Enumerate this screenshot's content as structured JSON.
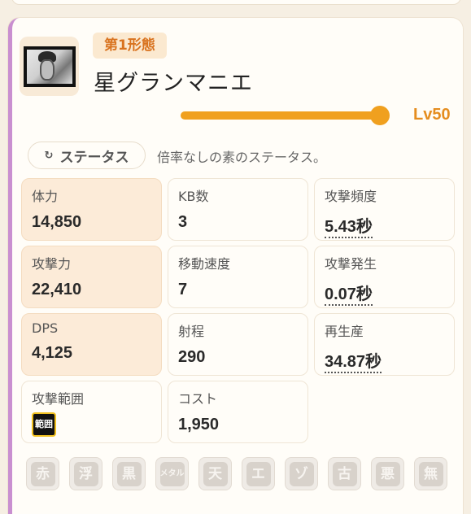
{
  "unit": {
    "form_label": "第1形態",
    "name": "星グランマニエ"
  },
  "level": {
    "label": "Lv50",
    "value": 50,
    "fill_fraction": 1.0
  },
  "status": {
    "button_label": "ステータス",
    "button_icon": "refresh-icon",
    "description": "倍率なしの素のステータス。"
  },
  "stats": [
    {
      "label": "体力",
      "value": "14,850"
    },
    {
      "label": "KB数",
      "value": "3"
    },
    {
      "label": "攻撃頻度",
      "value": "5.43秒"
    },
    {
      "label": "攻撃力",
      "value": "22,410"
    },
    {
      "label": "移動速度",
      "value": "7"
    },
    {
      "label": "攻撃発生",
      "value": "0.07秒"
    },
    {
      "label": "DPS",
      "value": "4,125"
    },
    {
      "label": "射程",
      "value": "290"
    },
    {
      "label": "再生産",
      "value": "34.87秒"
    },
    {
      "label": "攻撃範囲",
      "value": "範囲"
    },
    {
      "label": "コスト",
      "value": "1,950"
    }
  ],
  "traits": [
    "赤",
    "浮",
    "黒",
    "メタル",
    "天",
    "エ",
    "ゾ",
    "古",
    "悪",
    "無"
  ],
  "colors": {
    "accent": "#f0a01f",
    "level_text": "#e58d1f",
    "form_badge_text": "#d9731f",
    "card_border_left": "#c98fd0",
    "highlight_cell": "#fcebd8"
  }
}
